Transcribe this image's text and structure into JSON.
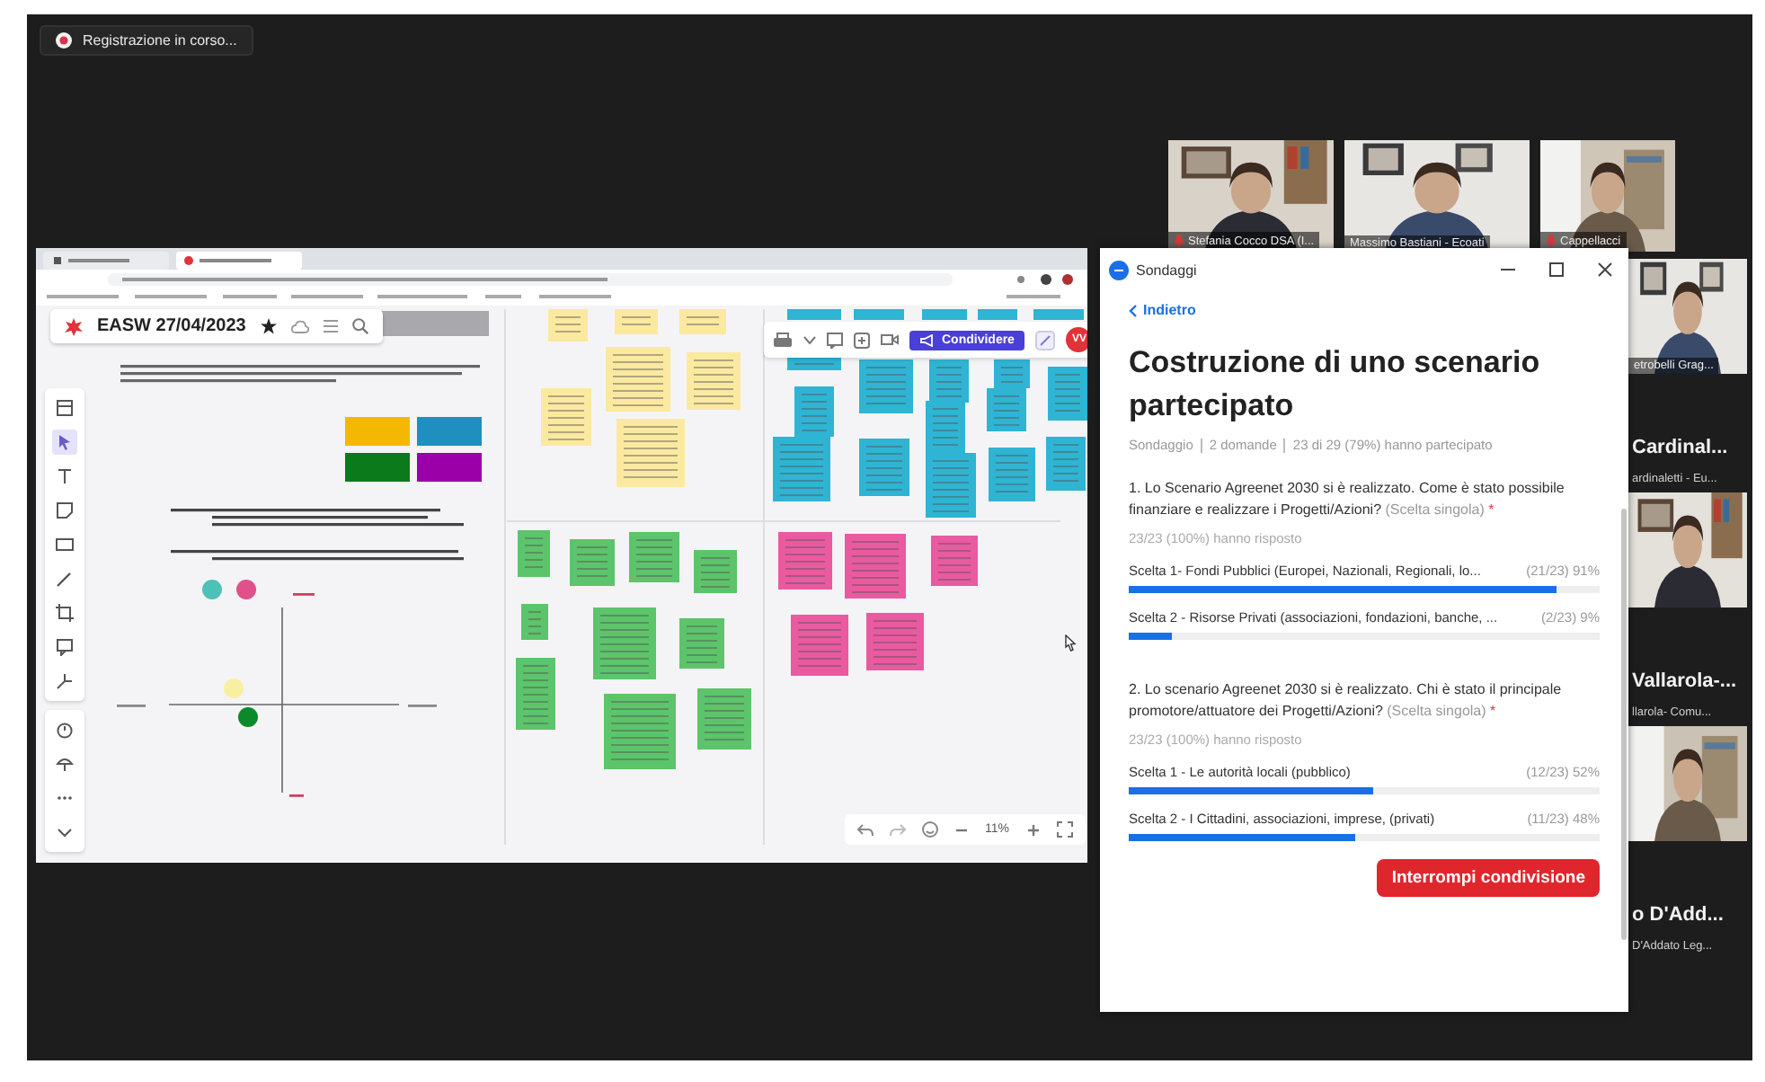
{
  "recording": {
    "label": "Registrazione in corso..."
  },
  "shared_screen": {
    "board_title": "EASW 27/04/2023",
    "share_button": "Condividere",
    "avatar": "VV",
    "zoom_level": "11%"
  },
  "poll": {
    "window_title": "Sondaggi",
    "back": "Indietro",
    "title": "Costruzione di uno scenario partecipato",
    "meta": [
      "Sondaggio",
      "2 domande",
      "23 di 29 (79%) hanno partecipato"
    ],
    "questions": [
      {
        "text": "1. Lo Scenario Agreenet 2030 si è realizzato. Come è stato possibile finanziare e realizzare i Progetti/Azioni?",
        "type": "(Scelta singola)",
        "required_mark": "*",
        "answered": "23/23 (100%) hanno risposto",
        "options": [
          {
            "label": "Scelta 1- Fondi Pubblici (Europei, Nazionali, Regionali, lo...",
            "result": "(21/23) 91%",
            "level": 0.91
          },
          {
            "label": "Scelta 2 - Risorse Privati (associazioni, fondazioni, banche, ...",
            "result": "(2/23) 9%",
            "level": 0.09
          }
        ]
      },
      {
        "text": "2. Lo scenario Agreenet 2030 si è realizzato. Chi è stato il principale promotore/attuatore dei Progetti/Azioni?",
        "type": "(Scelta singola)",
        "required_mark": "*",
        "answered": "23/23 (100%) hanno risposto",
        "options": [
          {
            "label": "Scelta 1 - Le autorità locali (pubblico)",
            "result": "(12/23) 52%",
            "level": 0.52
          },
          {
            "label": "Scelta 2 - I Cittadini, associazioni, imprese, (privati)",
            "result": "(11/23) 48%",
            "level": 0.48
          }
        ]
      }
    ],
    "stop_button": "Interrompi condivisione"
  },
  "participants": {
    "top_row": [
      {
        "name": "Stefania Cocco DSA (I...",
        "muted": true
      },
      {
        "name": "Massimo Bastiani - Ecoati",
        "muted": false
      },
      {
        "name": "Cappellacci",
        "muted": true
      }
    ],
    "side_column": [
      {
        "kind": "video",
        "name": "etrobelli Grag..."
      },
      {
        "kind": "name",
        "display_name": "Cardinal...",
        "name": "ardinaletti - Eu..."
      },
      {
        "kind": "video"
      },
      {
        "kind": "name",
        "display_name": "Vallarola-...",
        "name": "llarola- Comu..."
      },
      {
        "kind": "video"
      },
      {
        "kind": "name",
        "display_name": "o D'Add...",
        "name": "D'Addato Leg..."
      }
    ]
  }
}
